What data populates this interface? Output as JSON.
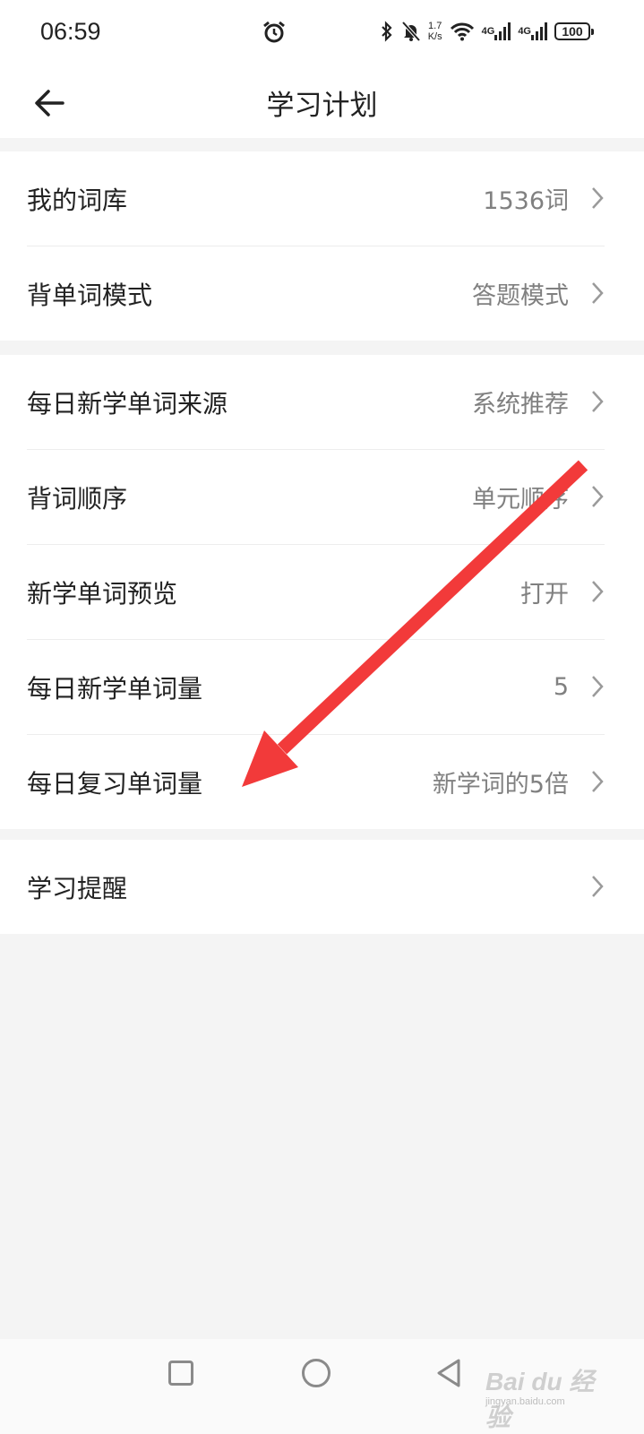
{
  "status_bar": {
    "time": "06:59",
    "speed_value": "1.7",
    "speed_unit": "K/s",
    "network_1": "4G",
    "network_2": "4G",
    "battery": "100",
    "icons": [
      "alarm-icon",
      "bluetooth-icon",
      "mute-icon",
      "wifi-icon",
      "signal-icon",
      "signal-icon",
      "battery-icon"
    ]
  },
  "header": {
    "title": "学习计划",
    "back_icon": "back-arrow-icon"
  },
  "groups": [
    {
      "items": [
        {
          "label": "我的词库",
          "value": "1536词"
        },
        {
          "label": "背单词模式",
          "value": "答题模式"
        }
      ]
    },
    {
      "items": [
        {
          "label": "每日新学单词来源",
          "value": "系统推荐"
        },
        {
          "label": "背词顺序",
          "value": "单元顺序"
        },
        {
          "label": "新学单词预览",
          "value": "打开"
        },
        {
          "label": "每日新学单词量",
          "value": "5"
        },
        {
          "label": "每日复习单词量",
          "value": "新学词的5倍"
        }
      ]
    },
    {
      "items": [
        {
          "label": "学习提醒",
          "value": ""
        }
      ]
    }
  ],
  "annotation": {
    "arrow_color": "#f23a3a"
  },
  "nav_bar": {
    "icons": [
      "recent-apps-icon",
      "home-icon",
      "back-triangle-icon"
    ]
  },
  "watermark": {
    "brand": "Bai du 经验",
    "url": "jingyan.baidu.com"
  }
}
